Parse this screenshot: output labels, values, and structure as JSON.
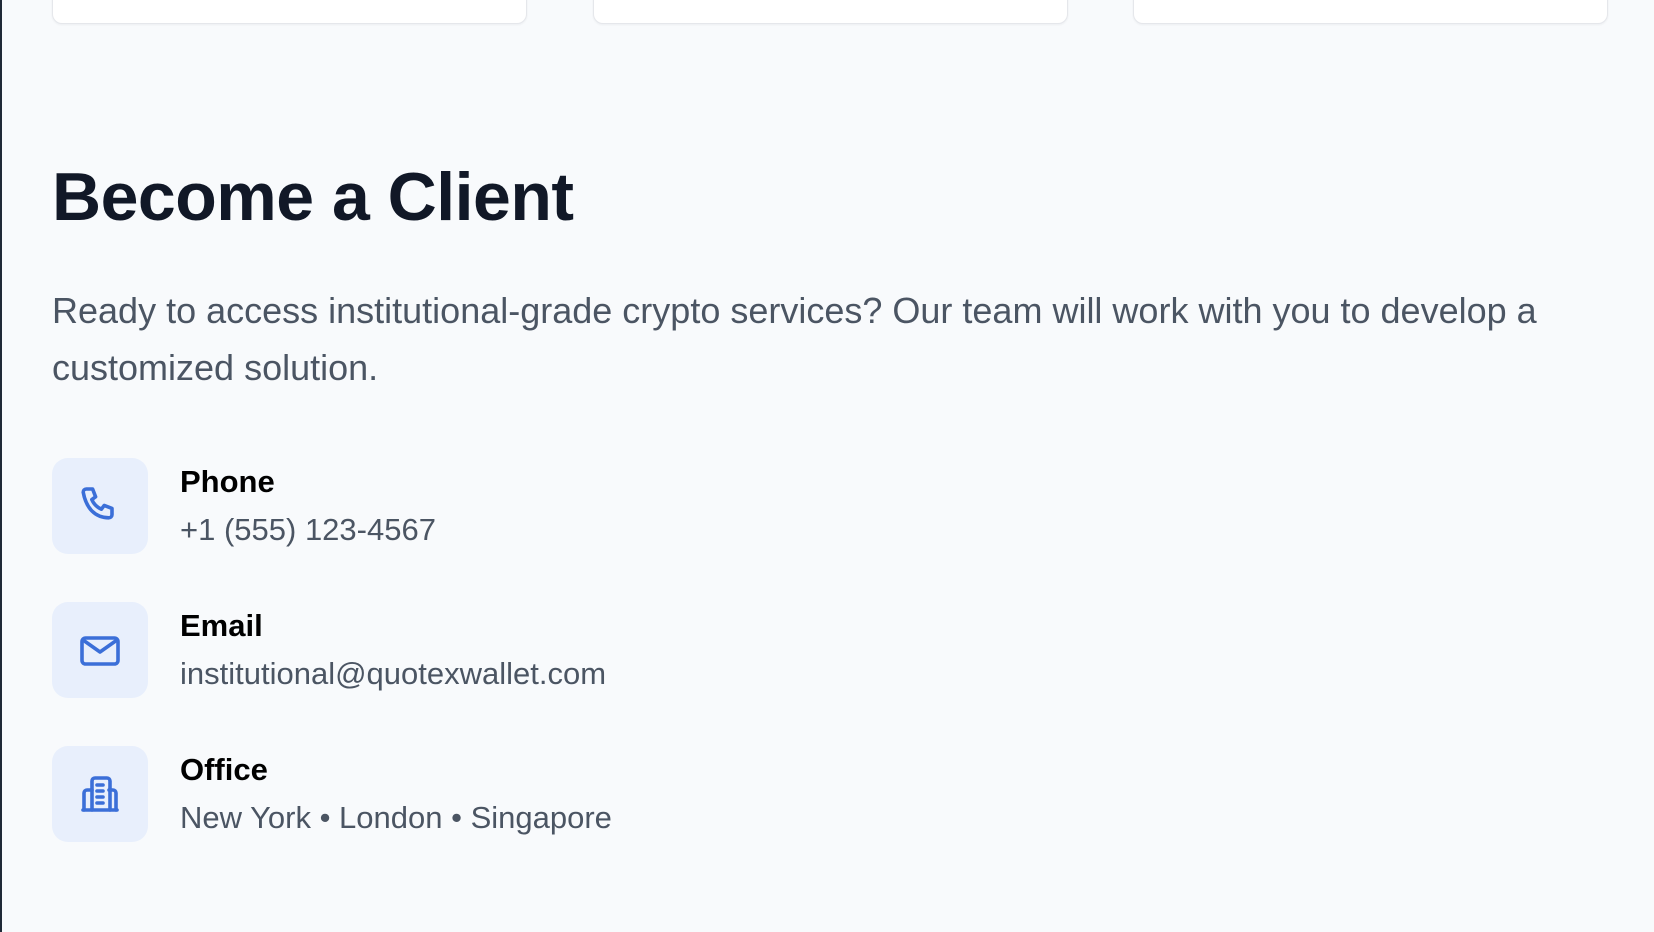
{
  "section": {
    "title": "Become a Client",
    "description": "Ready to access institutional-grade crypto services? Our team will work with you to develop a customized solution."
  },
  "contacts": [
    {
      "icon": "phone-icon",
      "label": "Phone",
      "value": "+1 (555) 123-4567"
    },
    {
      "icon": "mail-icon",
      "label": "Email",
      "value": "institutional@quotexwallet.com"
    },
    {
      "icon": "building-icon",
      "label": "Office",
      "value": "New York • London • Singapore"
    }
  ],
  "colors": {
    "background": "#f8fafc",
    "heading": "#111827",
    "body_text": "#4b5563",
    "icon_accent": "#3b6fd8",
    "icon_bg": "#e8effc"
  }
}
